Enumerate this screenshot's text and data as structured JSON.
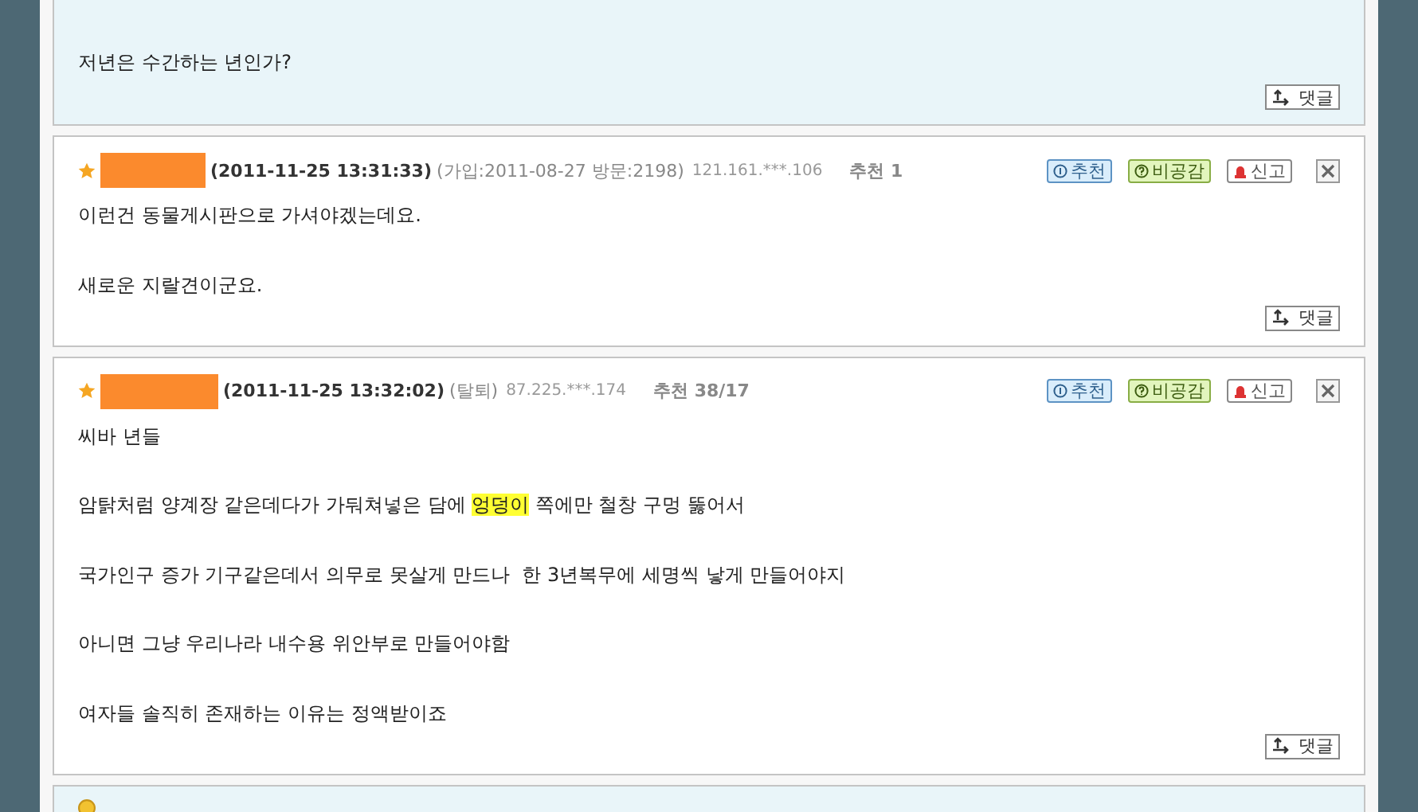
{
  "comments": [
    {
      "kind": "tail",
      "highlighted": true,
      "paragraphs": [
        [
          {
            "text": "저년은 수간하는 년인가?",
            "marked": false
          }
        ]
      ],
      "reply": "댓글"
    },
    {
      "kind": "full",
      "highlighted": false,
      "datetime": "(2011-11-25 13:31:33)",
      "member_info": "(가입:2011-08-27 방문:2198)",
      "ip": "121.161.***.106",
      "recommend": "추천 1",
      "actions": [
        "추천",
        "비공감",
        "신고"
      ],
      "paragraphs": [
        [
          {
            "text": "이런건 동물게시판으로 가셔야겠는데요.",
            "marked": false
          }
        ],
        [
          {
            "text": "새로운 지랄견이군요.",
            "marked": false
          }
        ]
      ],
      "reply": "댓글"
    },
    {
      "kind": "full",
      "highlighted": false,
      "datetime": "(2011-11-25 13:32:02)",
      "member_info": "(탈퇴)",
      "ip": "87.225.***.174",
      "recommend": "추천 38/17",
      "actions": [
        "추천",
        "비공감",
        "신고"
      ],
      "paragraphs": [
        [
          {
            "text": "씨바 년들",
            "marked": false
          }
        ],
        [
          {
            "text": "암탉처럼 양계장 같은데다가 가둬쳐넣은 담에 ",
            "marked": false
          },
          {
            "text": "엉덩이",
            "marked": true
          },
          {
            "text": " 쪽에만 철창 구멍 뚫어서",
            "marked": false
          }
        ],
        [
          {
            "text": "국가인구 증가 기구같은데서 의무로 못살게 만드나  한 3년복무에 세명씩 낳게 만들어야지",
            "marked": false
          }
        ],
        [
          {
            "text": "아니면 그냥 우리나라 내수용 위안부로 만들어야함",
            "marked": false
          }
        ],
        [
          {
            "text": "여자들 솔직히 존재하는 이유는 정액받이죠",
            "marked": false
          }
        ]
      ],
      "reply": "댓글"
    },
    {
      "kind": "head",
      "highlighted": true
    }
  ]
}
